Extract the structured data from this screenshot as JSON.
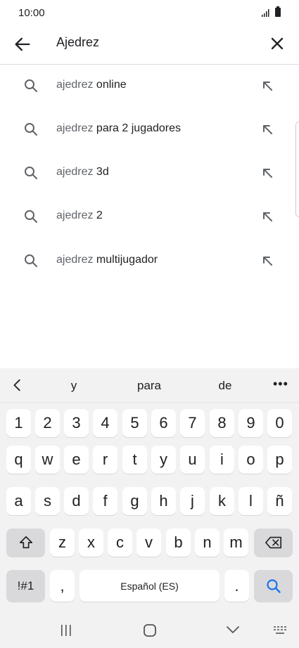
{
  "status_bar": {
    "time": "10:00"
  },
  "search": {
    "query": "Ajedrez"
  },
  "suggestions": [
    {
      "prefix": "ajedrez",
      "suffix": " online"
    },
    {
      "prefix": "ajedrez",
      "suffix": " para 2 jugadores"
    },
    {
      "prefix": "ajedrez",
      "suffix": " 3d"
    },
    {
      "prefix": "ajedrez",
      "suffix": " 2"
    },
    {
      "prefix": "ajedrez",
      "suffix": " multijugador"
    }
  ],
  "keyboard": {
    "predictions": [
      "y",
      "para",
      "de"
    ],
    "more_label": "•••",
    "row_numbers": [
      "1",
      "2",
      "3",
      "4",
      "5",
      "6",
      "7",
      "8",
      "9",
      "0"
    ],
    "row1": [
      "q",
      "w",
      "e",
      "r",
      "t",
      "y",
      "u",
      "i",
      "o",
      "p"
    ],
    "row2": [
      "a",
      "s",
      "d",
      "f",
      "g",
      "h",
      "j",
      "k",
      "l",
      "ñ"
    ],
    "row3": [
      "z",
      "x",
      "c",
      "v",
      "b",
      "n",
      "m"
    ],
    "symbols_label": "!#1",
    "comma_label": ",",
    "space_label": "Español (ES)",
    "period_label": "."
  },
  "icons": {
    "back": "arrow-left-icon",
    "clear": "close-icon",
    "suggestion": "search-icon",
    "fill": "arrow-up-left-icon",
    "shift": "shift-icon",
    "backspace": "backspace-icon",
    "search_key": "search-icon"
  },
  "colors": {
    "accent": "#1a73e8",
    "text": "#202124",
    "muted": "#5f6368"
  }
}
